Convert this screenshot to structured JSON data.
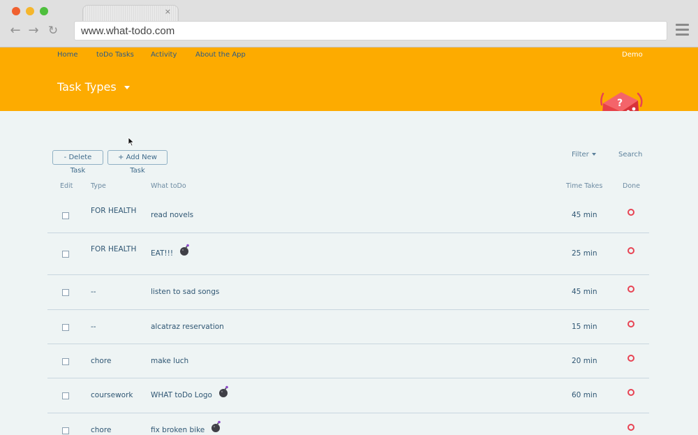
{
  "browser": {
    "url": "www.what-todo.com",
    "tab_close": "×"
  },
  "site": {
    "nav": [
      "Home",
      "toDo Tasks",
      "Activity",
      "About the App"
    ],
    "user": "Demo",
    "task_types": "Task Types"
  },
  "toolbar": {
    "delete_label": "- Delete Task",
    "add_label": "+ Add New Task",
    "filter_label": "Filter",
    "search_label": "Search"
  },
  "table": {
    "headers": [
      "Edit",
      "Type",
      "What toDo",
      "Time Takes",
      "Done"
    ],
    "rows": [
      {
        "type": "FOR HEALTH",
        "what": "read novels",
        "time": "45 min",
        "bomb": false
      },
      {
        "type": "FOR HEALTH",
        "what": "EAT!!!",
        "time": "25 min",
        "bomb": true
      },
      {
        "type": "--",
        "what": "listen to sad songs",
        "time": "45 min",
        "bomb": false
      },
      {
        "type": "--",
        "what": "alcatraz reservation",
        "time": "15 min",
        "bomb": false
      },
      {
        "type": "chore",
        "what": "make luch",
        "time": "20 min",
        "bomb": false
      },
      {
        "type": "coursework",
        "what": "WHAT toDo Logo",
        "time": "60 min",
        "bomb": true
      },
      {
        "type": "chore",
        "what": "fix broken bike",
        "time": "",
        "bomb": true
      }
    ]
  },
  "colors": {
    "header": "#fdab00",
    "background": "#eef4f4",
    "done_circle": "#e84353",
    "text": "#2f5673"
  }
}
